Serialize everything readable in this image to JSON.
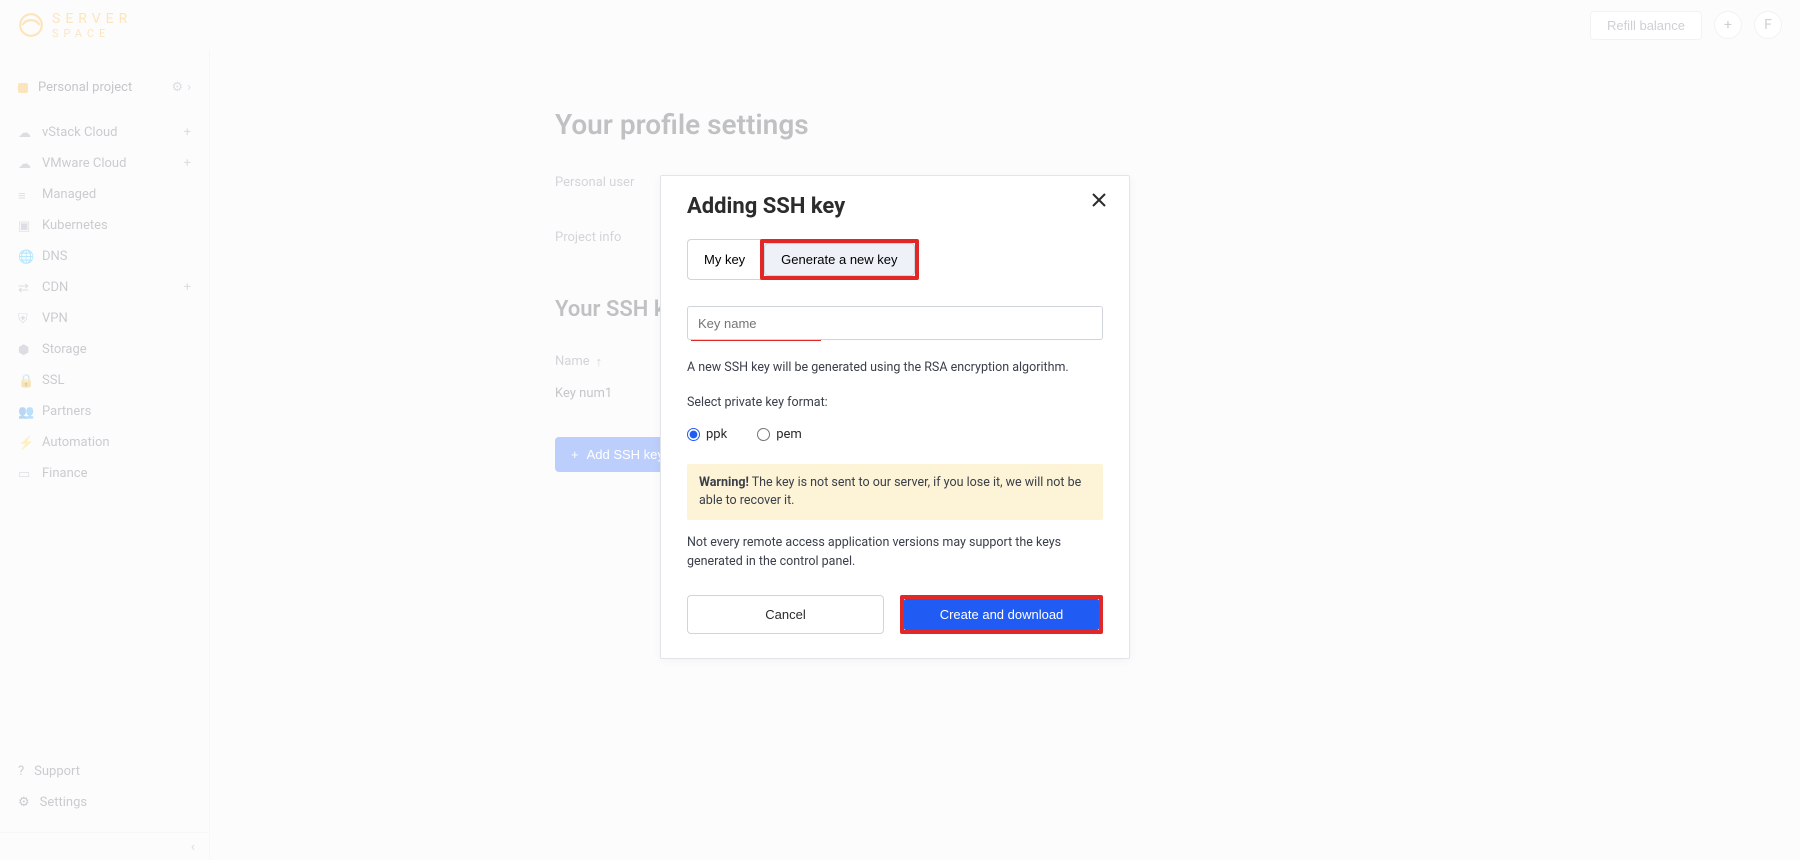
{
  "header": {
    "brand_top": "SERVER",
    "brand_bottom": "SPACE",
    "refill": "Refill balance",
    "avatar_letter": "F"
  },
  "sidebar": {
    "project": "Personal project",
    "items": [
      {
        "label": "vStack Cloud",
        "icon": "cloud",
        "plus": true
      },
      {
        "label": "VMware Cloud",
        "icon": "cloud",
        "plus": true
      },
      {
        "label": "Managed",
        "icon": "sliders"
      },
      {
        "label": "Kubernetes",
        "icon": "cube"
      },
      {
        "label": "DNS",
        "icon": "globe"
      },
      {
        "label": "CDN",
        "icon": "network",
        "plus": true
      },
      {
        "label": "VPN",
        "icon": "shield"
      },
      {
        "label": "Storage",
        "icon": "disk"
      },
      {
        "label": "SSL",
        "icon": "lock"
      },
      {
        "label": "Partners",
        "icon": "users"
      },
      {
        "label": "Automation",
        "icon": "bolt"
      },
      {
        "label": "Finance",
        "icon": "card"
      }
    ],
    "bottom": [
      {
        "label": "Support",
        "icon": "help"
      },
      {
        "label": "Settings",
        "icon": "gear"
      }
    ]
  },
  "page": {
    "title": "Your profile settings",
    "tabs": [
      "Personal user",
      "Project info"
    ],
    "section_title": "Your SSH keys",
    "table_header": "Name",
    "rows": [
      "Key num1"
    ],
    "add_button": "Add SSH key"
  },
  "modal": {
    "title": "Adding SSH key",
    "tab_my": "My key",
    "tab_gen": "Generate a new key",
    "placeholder": "Key name",
    "hint1": "A new SSH key will be generated using the RSA encryption algorithm.",
    "format_label": "Select private key format:",
    "radio_ppk": "ppk",
    "radio_pem": "pem",
    "warn_bold": "Warning!",
    "warn_text": " The key is not sent to our server, if you lose it, we will not be able to recover it.",
    "hint2": "Not every remote access application versions may support the keys generated in the control panel.",
    "cancel": "Cancel",
    "create": "Create and download"
  }
}
